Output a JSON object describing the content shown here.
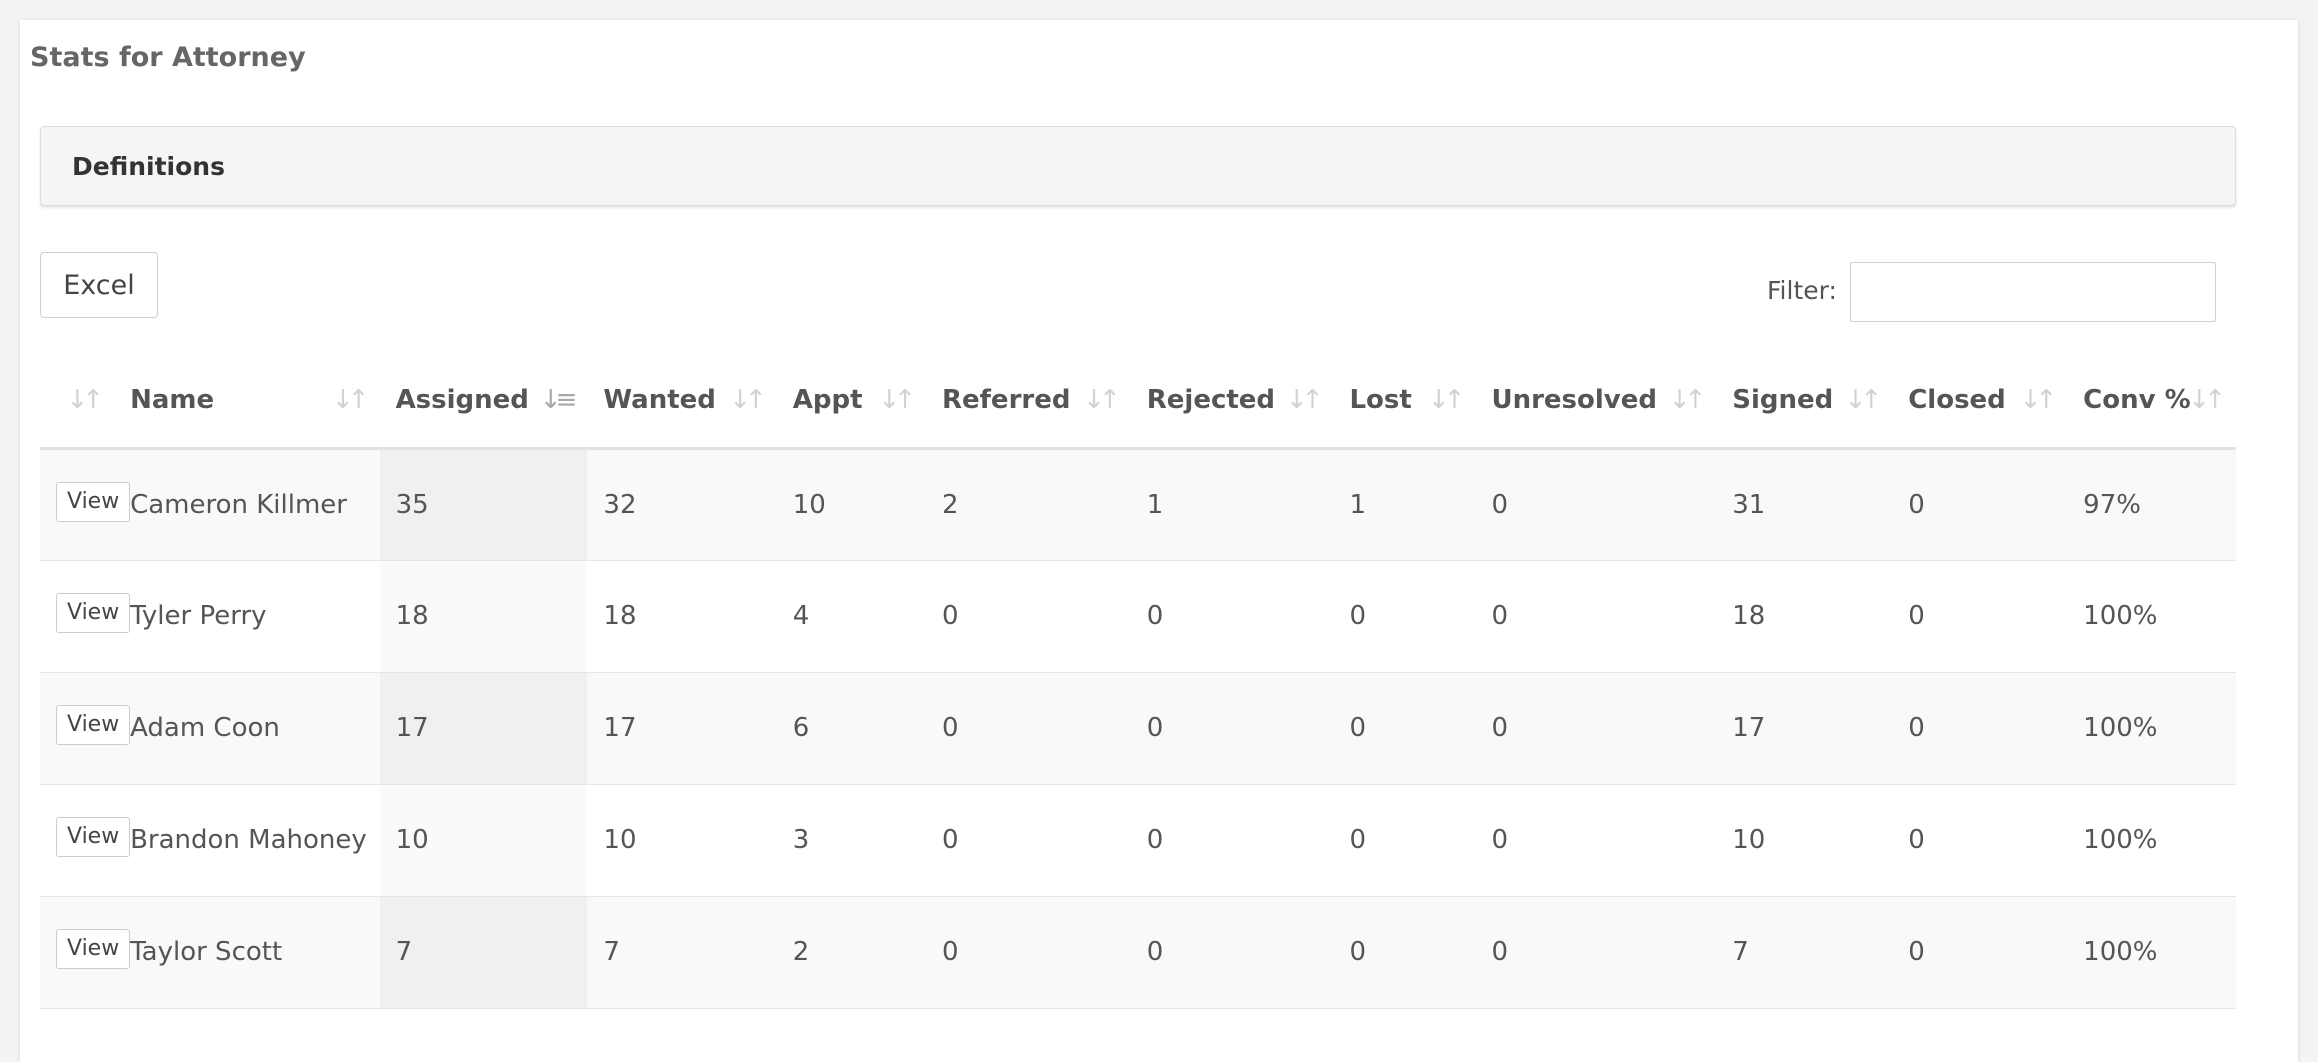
{
  "page": {
    "title": "Stats for Attorney",
    "definitions_label": "Definitions",
    "excel_label": "Excel",
    "filter_label": "Filter:",
    "filter_value": ""
  },
  "table": {
    "columns": [
      {
        "label": ""
      },
      {
        "label": "Name"
      },
      {
        "label": "Assigned"
      },
      {
        "label": "Wanted"
      },
      {
        "label": "Appt"
      },
      {
        "label": "Referred"
      },
      {
        "label": "Rejected"
      },
      {
        "label": "Lost"
      },
      {
        "label": "Unresolved"
      },
      {
        "label": "Signed"
      },
      {
        "label": "Closed"
      },
      {
        "label": "Conv %"
      }
    ],
    "sorted_column": "Assigned",
    "sort_direction": "descending",
    "rows": [
      {
        "action": "View",
        "name": "Cameron Killmer",
        "assigned": "35",
        "wanted": "32",
        "appt": "10",
        "referred": "2",
        "rejected": "1",
        "lost": "1",
        "unresolved": "0",
        "signed": "31",
        "closed": "0",
        "conv": "97%"
      },
      {
        "action": "View",
        "name": "Tyler Perry",
        "assigned": "18",
        "wanted": "18",
        "appt": "4",
        "referred": "0",
        "rejected": "0",
        "lost": "0",
        "unresolved": "0",
        "signed": "18",
        "closed": "0",
        "conv": "100%"
      },
      {
        "action": "View",
        "name": "Adam Coon",
        "assigned": "17",
        "wanted": "17",
        "appt": "6",
        "referred": "0",
        "rejected": "0",
        "lost": "0",
        "unresolved": "0",
        "signed": "17",
        "closed": "0",
        "conv": "100%"
      },
      {
        "action": "View",
        "name": "Brandon Mahoney",
        "assigned": "10",
        "wanted": "10",
        "appt": "3",
        "referred": "0",
        "rejected": "0",
        "lost": "0",
        "unresolved": "0",
        "signed": "10",
        "closed": "0",
        "conv": "100%"
      },
      {
        "action": "View",
        "name": "Taylor Scott",
        "assigned": "7",
        "wanted": "7",
        "appt": "2",
        "referred": "0",
        "rejected": "0",
        "lost": "0",
        "unresolved": "0",
        "signed": "7",
        "closed": "0",
        "conv": "100%"
      }
    ]
  },
  "icons": {
    "sort_default": "sort-both-icon",
    "sort_active": "sort-descending-icon"
  }
}
